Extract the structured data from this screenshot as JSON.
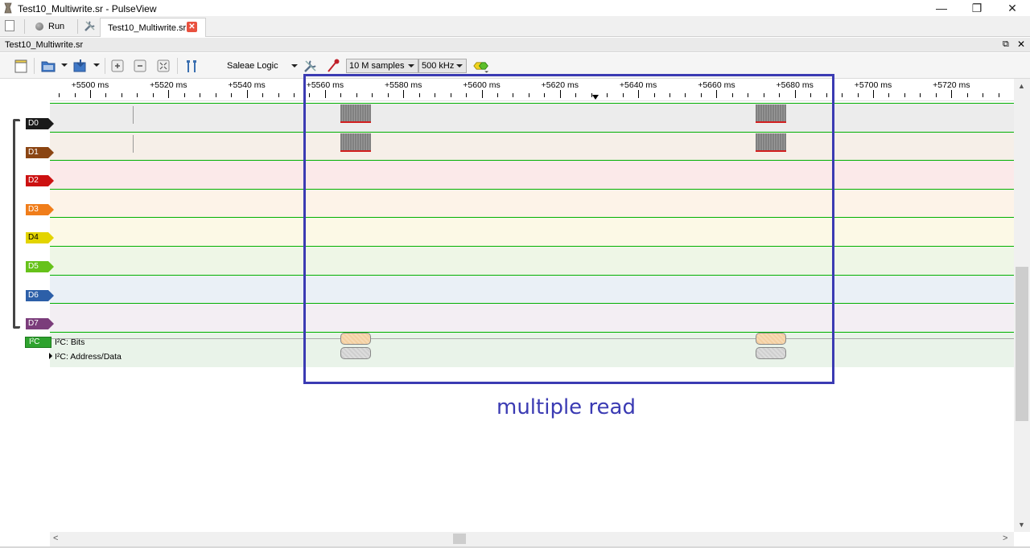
{
  "window": {
    "title": "Test10_Multiwrite.sr - PulseView",
    "minimize": "—",
    "maximize": "❐",
    "close": "✕"
  },
  "tabbar": {
    "run_label": "Run",
    "doc_tab_label": "Test10_Multiwrite.sr",
    "doc_tab_close": "✕"
  },
  "dock": {
    "title": "Test10_Multiwrite.sr",
    "float": "⧉",
    "close": "✕"
  },
  "toolbar": {
    "device": "Saleae Logic",
    "samples": "10 M samples",
    "samplerate": "500 kHz"
  },
  "ruler": {
    "ticks": [
      "+5500 ms",
      "+5520 ms",
      "+5540 ms",
      "+5560 ms",
      "+5580 ms",
      "+5600 ms",
      "+5620 ms",
      "+5640 ms",
      "+5660 ms",
      "+5680 ms",
      "+5700 ms",
      "+5720 ms"
    ]
  },
  "channels": [
    {
      "label": "D0",
      "color": "#1a1a1a",
      "bg": "#ececec"
    },
    {
      "label": "D1",
      "color": "#8b4513",
      "bg": "#f6efe8"
    },
    {
      "label": "D2",
      "color": "#cc1111",
      "bg": "#fbe9e9"
    },
    {
      "label": "D3",
      "color": "#f07d1a",
      "bg": "#fdf3e8"
    },
    {
      "label": "D4",
      "color": "#e3d400",
      "bg": "#fcf9e6"
    },
    {
      "label": "D5",
      "color": "#66c21a",
      "bg": "#eef6e6"
    },
    {
      "label": "D6",
      "color": "#2c5fa8",
      "bg": "#eaf0f6"
    },
    {
      "label": "D7",
      "color": "#7b3d7b",
      "bg": "#f3eef3"
    }
  ],
  "decoder": {
    "tag": "I²C",
    "rows": [
      "I²C: Bits",
      "I²C: Address/Data"
    ],
    "color": "#2fa32f"
  },
  "annotation": {
    "text": "multiple read",
    "color": "#3b3bb3"
  },
  "scroll": {
    "up": "▲",
    "down": "▼",
    "left": "<",
    "right": ">"
  }
}
